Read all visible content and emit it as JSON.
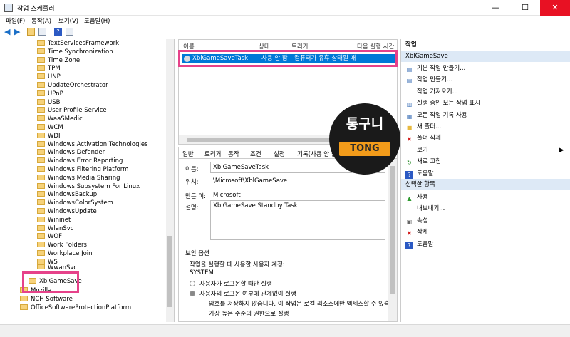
{
  "window": {
    "title": "작업 스케줄러",
    "minimize": "—",
    "maximize": "☐",
    "close": "✕"
  },
  "menu": [
    "파일(F)",
    "동작(A)",
    "보기(V)",
    "도움말(H)"
  ],
  "tree": {
    "items": [
      "TextServicesFramework",
      "Time Synchronization",
      "Time Zone",
      "TPM",
      "UNP",
      "UpdateOrchestrator",
      "UPnP",
      "USB",
      "User Profile Service",
      "WaaSMedic",
      "WCM",
      "WDI",
      "Windows Activation Technologies",
      "Windows Defender",
      "Windows Error Reporting",
      "Windows Filtering Platform",
      "Windows Media Sharing",
      "Windows Subsystem For Linux",
      "WindowsBackup",
      "WindowsColorSystem",
      "WindowsUpdate",
      "Wininet",
      "WlanSvc",
      "WOF",
      "Work Folders",
      "Workplace Join",
      "WS"
    ],
    "selected": "XblGameSave",
    "partial_above": "WwanSvc",
    "after": [
      "Mozilla",
      "NCH Software",
      "OfficeSoftwareProtectionPlatform"
    ]
  },
  "tasklist": {
    "columns": [
      "이름",
      "상태",
      "트리거",
      "다음 실행 시간"
    ],
    "row": {
      "name": "XblGameSaveTask",
      "status": "사용 안 함",
      "trigger": "컴퓨터가 유휴 상태일 때"
    }
  },
  "details": {
    "tabs": [
      "일반",
      "트리거",
      "동작",
      "조건",
      "설정",
      "기록(사용 안 함)"
    ],
    "name_label": "이름:",
    "name_value": "XblGameSaveTask",
    "location_label": "위치:",
    "location_value": "\\Microsoft\\XblGameSave",
    "author_label": "만든 이:",
    "author_value": "Microsoft",
    "desc_label": "설명:",
    "desc_value": "XblGameSave Standby Task",
    "security_title": "보안 옵션",
    "run_account_label": "작업을 실행할 때 사용할 사용자 계정:",
    "run_account_value": "SYSTEM",
    "opt1": "사용자가 로그온할 때만 실행",
    "opt2": "사용자의 로그온 여부에 관계없이 실행",
    "opt3": "암호를 저장하지 않습니다. 이 작업은 로컬 리소스에만 액세스할 수 있습니다",
    "opt4": "가장 높은 수준의 권한으로 실행"
  },
  "actions": {
    "header": "작업",
    "section1": "XblGameSave",
    "items1": [
      {
        "icon": "folder-task-icon",
        "label": "기본 작업 만들기..."
      },
      {
        "icon": "create-task-icon",
        "label": "작업 만들기..."
      },
      {
        "icon": "none",
        "label": "작업 가져오기..."
      },
      {
        "icon": "running-tasks-icon",
        "label": "실행 중인 모든 작업 표시"
      },
      {
        "icon": "history-icon",
        "label": "모든 작업 기록 사용"
      },
      {
        "icon": "new-folder-icon",
        "label": "새 폴더..."
      },
      {
        "icon": "delete-icon",
        "label": "폴더 삭제"
      },
      {
        "icon": "none",
        "label": "보기"
      },
      {
        "icon": "refresh-icon",
        "label": "새로 고침"
      },
      {
        "icon": "help-icon",
        "label": "도움말"
      }
    ],
    "section2": "선택한 항목",
    "items2": [
      {
        "icon": "enable-icon",
        "label": "사용"
      },
      {
        "icon": "none",
        "label": "내보내기..."
      },
      {
        "icon": "properties-icon",
        "label": "속성"
      },
      {
        "icon": "delete-icon",
        "label": "삭제"
      },
      {
        "icon": "help-icon",
        "label": "도움말"
      }
    ]
  },
  "watermark": {
    "line1": "통구니",
    "line2": "TONG"
  },
  "colors": {
    "selection": "#0078d7",
    "highlight": "#e6428a",
    "badge_bg": "#1a1a1a",
    "badge_tag": "#f29b1a"
  }
}
